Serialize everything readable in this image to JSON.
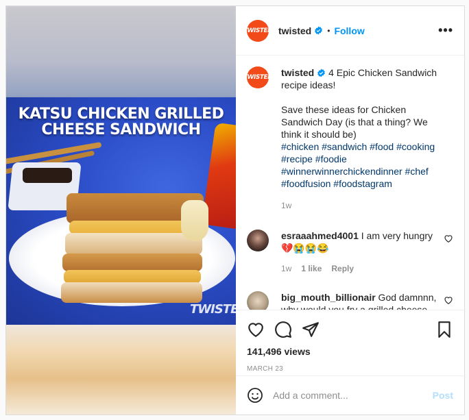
{
  "media": {
    "title_line1": "KATSU CHICKEN GRILLED",
    "title_line2": "CHEESE SANDWICH",
    "watermark": "TWISTED"
  },
  "header": {
    "avatar_text": "TWISTED",
    "username": "twisted",
    "separator": "•",
    "follow_label": "Follow",
    "more_label": "•••"
  },
  "caption": {
    "avatar_text": "TWISTED",
    "username": "twisted",
    "line1": " 4 Epic Chicken Sandwich recipe ideas!",
    "line2": "Save these ideas for Chicken Sandwich Day (is that a thing? We think it should be)",
    "hashtags": "#chicken #sandwich #food #cooking #recipe #foodie #winnerwinnerchickendinner #chef #foodfusion #foodstagram",
    "time": "1w"
  },
  "comments": [
    {
      "username": "esraaahmed4001",
      "text": " I am very hungry💔😭😭😂",
      "time": "1w",
      "likes": "1 like",
      "reply": "Reply"
    },
    {
      "username": "big_mouth_billionair",
      "text": " God damnnn, why would you fry a grilled cheese"
    }
  ],
  "stats": {
    "views": "141,496 views",
    "date": "MARCH 23"
  },
  "composer": {
    "placeholder": "Add a comment...",
    "post_label": "Post"
  },
  "colors": {
    "brand": "#f24a18",
    "follow": "#0095f6",
    "hashtag": "#00376b",
    "muted": "#8e8e8e",
    "post_disabled": "#b2dffc"
  }
}
